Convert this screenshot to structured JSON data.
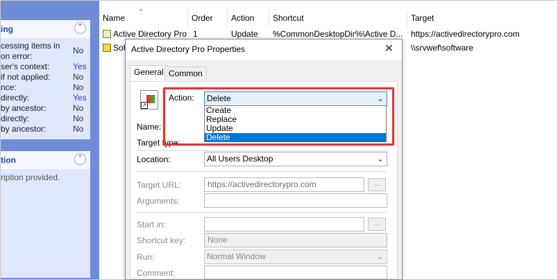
{
  "left_pane": {
    "section1": {
      "header": "ing",
      "rows": [
        {
          "label": "cessing items in",
          "value": "No"
        },
        {
          "label": "on error:",
          "value": ""
        },
        {
          "label": "ser's context:",
          "value": "Yes"
        },
        {
          "label": "if not applied:",
          "value": "No"
        },
        {
          "label": "nce:",
          "value": "No"
        },
        {
          "label": "directly:",
          "value": "Yes"
        },
        {
          "label": "by ancestor:",
          "value": "No"
        },
        {
          "label": "directly:",
          "value": "No"
        },
        {
          "label": "by ancestor:",
          "value": "No"
        }
      ]
    },
    "section2": {
      "header": "tion",
      "description": "ription provided."
    },
    "collapse_glyph": "⌃"
  },
  "list": {
    "columns": [
      "Name",
      "Order",
      "Action",
      "Shortcut",
      "Target"
    ],
    "rows": [
      {
        "name": "Active Directory Pro",
        "order": "1",
        "action": "Update",
        "shortcut": "%CommonDesktopDir%\\Active D...",
        "target": "https://activedirectorypro.com"
      },
      {
        "name": "Sof",
        "order": "",
        "action": "",
        "shortcut": "",
        "target": "\\\\srvwef\\software"
      }
    ]
  },
  "dialog": {
    "title": "Active Directory Pro Properties",
    "close": "✕",
    "tabs": [
      "General",
      "Common"
    ],
    "fields": {
      "action_label": "Action:",
      "action_value": "Delete",
      "action_options": [
        "Create",
        "Replace",
        "Update",
        "Delete"
      ],
      "name_label": "Name:",
      "target_type_label": "Target type:",
      "location_label": "Location:",
      "location_value": "All Users Desktop",
      "target_url_label": "Target URL:",
      "target_url_value": "https://activedirectorypro.com",
      "arguments_label": "Arguments:",
      "start_in_label": "Start in:",
      "shortcut_key_label": "Shortcut key:",
      "shortcut_key_value": "None",
      "run_label": "Run:",
      "run_value": "Normal Window",
      "comment_label": "Comment:",
      "ellipsis": "..."
    }
  },
  "colors": {
    "highlight": "#e0343c",
    "selection": "#0078d7",
    "pane_blue": "#6f8dd6"
  }
}
